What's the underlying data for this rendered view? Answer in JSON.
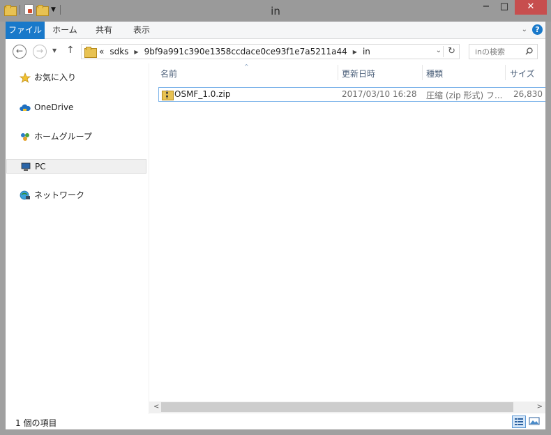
{
  "window": {
    "title": "in",
    "minimize_glyph": "−",
    "maximize_glyph": "□",
    "close_glyph": "✕"
  },
  "ribbon": {
    "tabs": [
      "ファイル",
      "ホーム",
      "共有",
      "表示"
    ],
    "help_glyph": "?"
  },
  "address": {
    "overflow": "«",
    "crumbs": [
      "sdks",
      "9bf9a991c390e1358ccdace0ce93f1e7a5211a44",
      "in"
    ],
    "search_placeholder": "inの検索"
  },
  "nav_pane": {
    "items": [
      {
        "label": "お気に入り",
        "icon": "star-icon"
      },
      {
        "label": "OneDrive",
        "icon": "cloud-icon"
      },
      {
        "label": "ホームグループ",
        "icon": "homegroup-icon"
      },
      {
        "label": "PC",
        "icon": "computer-icon",
        "selected": true
      },
      {
        "label": "ネットワーク",
        "icon": "network-icon"
      }
    ]
  },
  "file_list": {
    "columns": [
      "名前",
      "更新日時",
      "種類",
      "サイズ"
    ],
    "rows": [
      {
        "name": "OSMF_1.0.zip",
        "date": "2017/03/10 16:28",
        "type": "圧縮 (zip 形式) フ...",
        "size": "26,830"
      }
    ]
  },
  "status_bar": {
    "item_count": "1 個の項目"
  },
  "colors": {
    "accent": "#1979ca",
    "close": "#c74e4e",
    "selection_border": "#7eb4ea"
  }
}
